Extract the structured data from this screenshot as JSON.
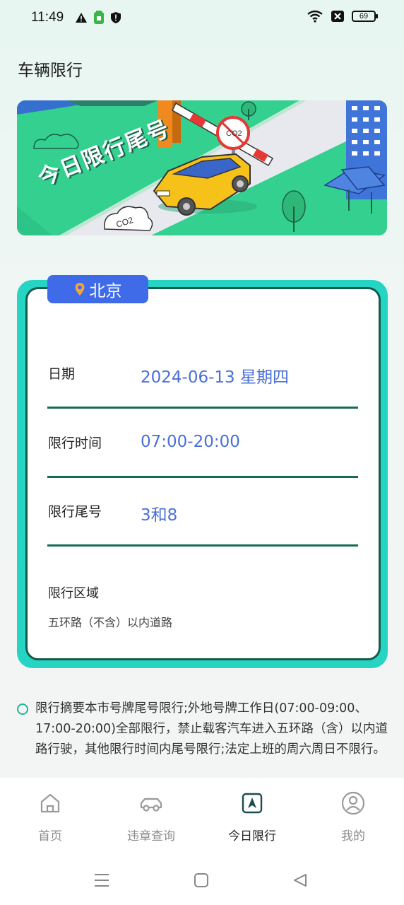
{
  "status_bar": {
    "time": "11:49",
    "battery": "69",
    "left_icons": [
      "warning-icon",
      "app-notification-icon",
      "shield-icon"
    ],
    "right_icons": [
      "wifi-icon",
      "sim-off-icon",
      "battery-icon"
    ]
  },
  "header": {
    "title": "车辆限行"
  },
  "banner": {
    "text": "今日限行尾号",
    "sign_text": "CO2",
    "smoke_text": "CO2"
  },
  "card": {
    "city": "北京",
    "rows": [
      {
        "label": "日期",
        "value": "2024-06-13 星期四"
      },
      {
        "label": "限行时间",
        "value": "07:00-20:00"
      },
      {
        "label": "限行尾号",
        "value": "3和8"
      }
    ],
    "region": {
      "label": "限行区域",
      "value": "五环路（不含）以内道路"
    }
  },
  "notice": {
    "text": "限行摘要本市号牌尾号限行;外地号牌工作日(07:00-09:00、17:00-20:00)全部限行，禁止载客汽车进入五环路（含）以内道路行驶，其他限行时间内尾号限行;法定上班的周六周日不限行。"
  },
  "bottom_nav": {
    "items": [
      {
        "label": "首页",
        "icon": "home-icon",
        "active": false
      },
      {
        "label": "违章查询",
        "icon": "car-icon",
        "active": false
      },
      {
        "label": "今日限行",
        "icon": "navigation-icon",
        "active": true
      },
      {
        "label": "我的",
        "icon": "profile-icon",
        "active": false
      }
    ]
  },
  "colors": {
    "accent": "#3f6be8",
    "card_border": "#26d4c3",
    "divider": "#176b55",
    "value_text": "#4a6fd8"
  }
}
